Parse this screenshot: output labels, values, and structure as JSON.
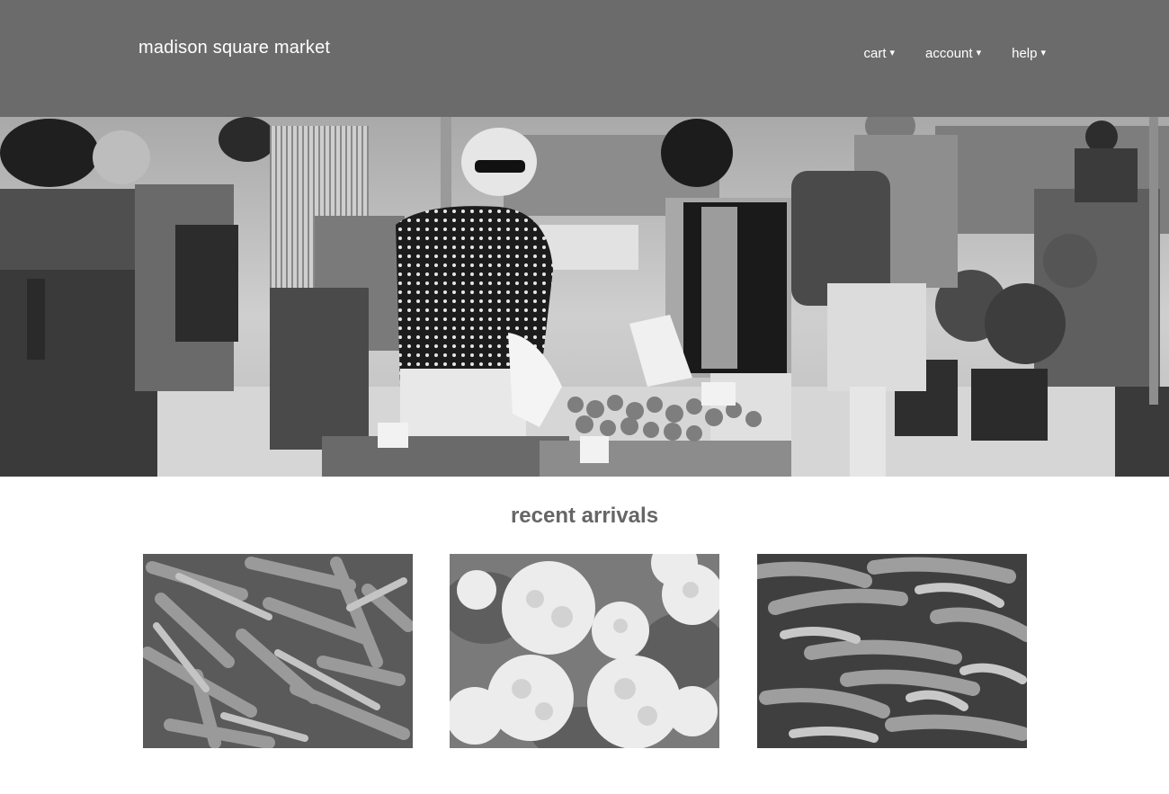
{
  "header": {
    "brand": "madison square market",
    "nav": [
      {
        "label": "cart",
        "icon": "chevron-down-icon"
      },
      {
        "label": "account",
        "icon": "chevron-down-icon"
      },
      {
        "label": "help",
        "icon": "chevron-down-icon"
      }
    ]
  },
  "main": {
    "section_title": "recent arrivals",
    "products": [
      {
        "subject": "carrots"
      },
      {
        "subject": "cauliflower"
      },
      {
        "subject": "peppers"
      }
    ]
  },
  "colors": {
    "header_bg": "#6b6b6b",
    "header_text": "#ffffff",
    "title_text": "#666666",
    "page_bg": "#ffffff"
  }
}
